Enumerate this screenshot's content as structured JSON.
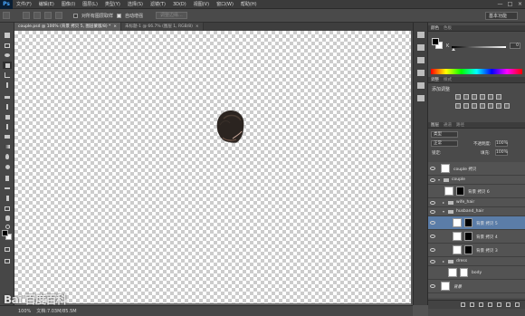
{
  "app": {
    "logo": "Ps"
  },
  "menu": [
    "文件(F)",
    "编辑(E)",
    "图像(I)",
    "图层(L)",
    "类型(Y)",
    "选择(S)",
    "滤镜(T)",
    "3D(D)",
    "视图(V)",
    "窗口(W)",
    "帮助(H)"
  ],
  "window_controls": [
    "—",
    "□",
    "×"
  ],
  "options": {
    "sample_all_label": "对所有图层取样",
    "auto_enhance_label": "自动增强",
    "refine_edge_label": "调整边缘...",
    "workspace": "基本功能"
  },
  "tabs": [
    {
      "label": "couple.psd @ 100% (背景 拷贝 5, 图层蒙版/8) *",
      "active": true
    },
    {
      "label": "未标题-1 @ 66.7% (图层 1, RGB/8)",
      "active": false
    }
  ],
  "status": {
    "zoom": "100%",
    "doc": "文档:7.03M/85.5M"
  },
  "watermark": "Bai 百度百科",
  "panels": {
    "color_tabs": [
      "颜色",
      "色板"
    ],
    "slider_label": "K",
    "slider_value": "0",
    "adjust_tabs": [
      "调整",
      "样式"
    ],
    "adjust_label": "添加调整",
    "layers_tabs": [
      "图层",
      "通道",
      "路径"
    ],
    "filter_type": "类型",
    "blend_mode": "正常",
    "opacity_label": "不透明度:",
    "opacity_value": "100%",
    "lock_label": "锁定:",
    "fill_label": "填充:",
    "fill_value": "100%"
  },
  "layers": [
    {
      "name": "couple 拷贝",
      "kind": "layer",
      "visible": true,
      "selected": false,
      "mask": false
    },
    {
      "name": "couple",
      "kind": "group",
      "visible": true,
      "selected": false,
      "mask": false
    },
    {
      "name": "背景 拷贝 6",
      "kind": "layer",
      "visible": false,
      "selected": false,
      "mask": true
    },
    {
      "name": "wife_hair",
      "kind": "group",
      "visible": true,
      "selected": false,
      "mask": false
    },
    {
      "name": "husband_hair",
      "kind": "group",
      "visible": true,
      "selected": false,
      "mask": false
    },
    {
      "name": "背景 拷贝 5",
      "kind": "layer",
      "visible": true,
      "selected": true,
      "mask": true
    },
    {
      "name": "背景 拷贝 4",
      "kind": "layer",
      "visible": true,
      "selected": false,
      "mask": true
    },
    {
      "name": "背景 拷贝 3",
      "kind": "layer",
      "visible": true,
      "selected": false,
      "mask": true
    },
    {
      "name": "dress",
      "kind": "group",
      "visible": true,
      "selected": false,
      "mask": false
    },
    {
      "name": "body",
      "kind": "layer",
      "visible": false,
      "selected": false,
      "mask": true
    },
    {
      "name": "背景",
      "kind": "layer",
      "visible": true,
      "selected": false,
      "mask": false
    }
  ]
}
